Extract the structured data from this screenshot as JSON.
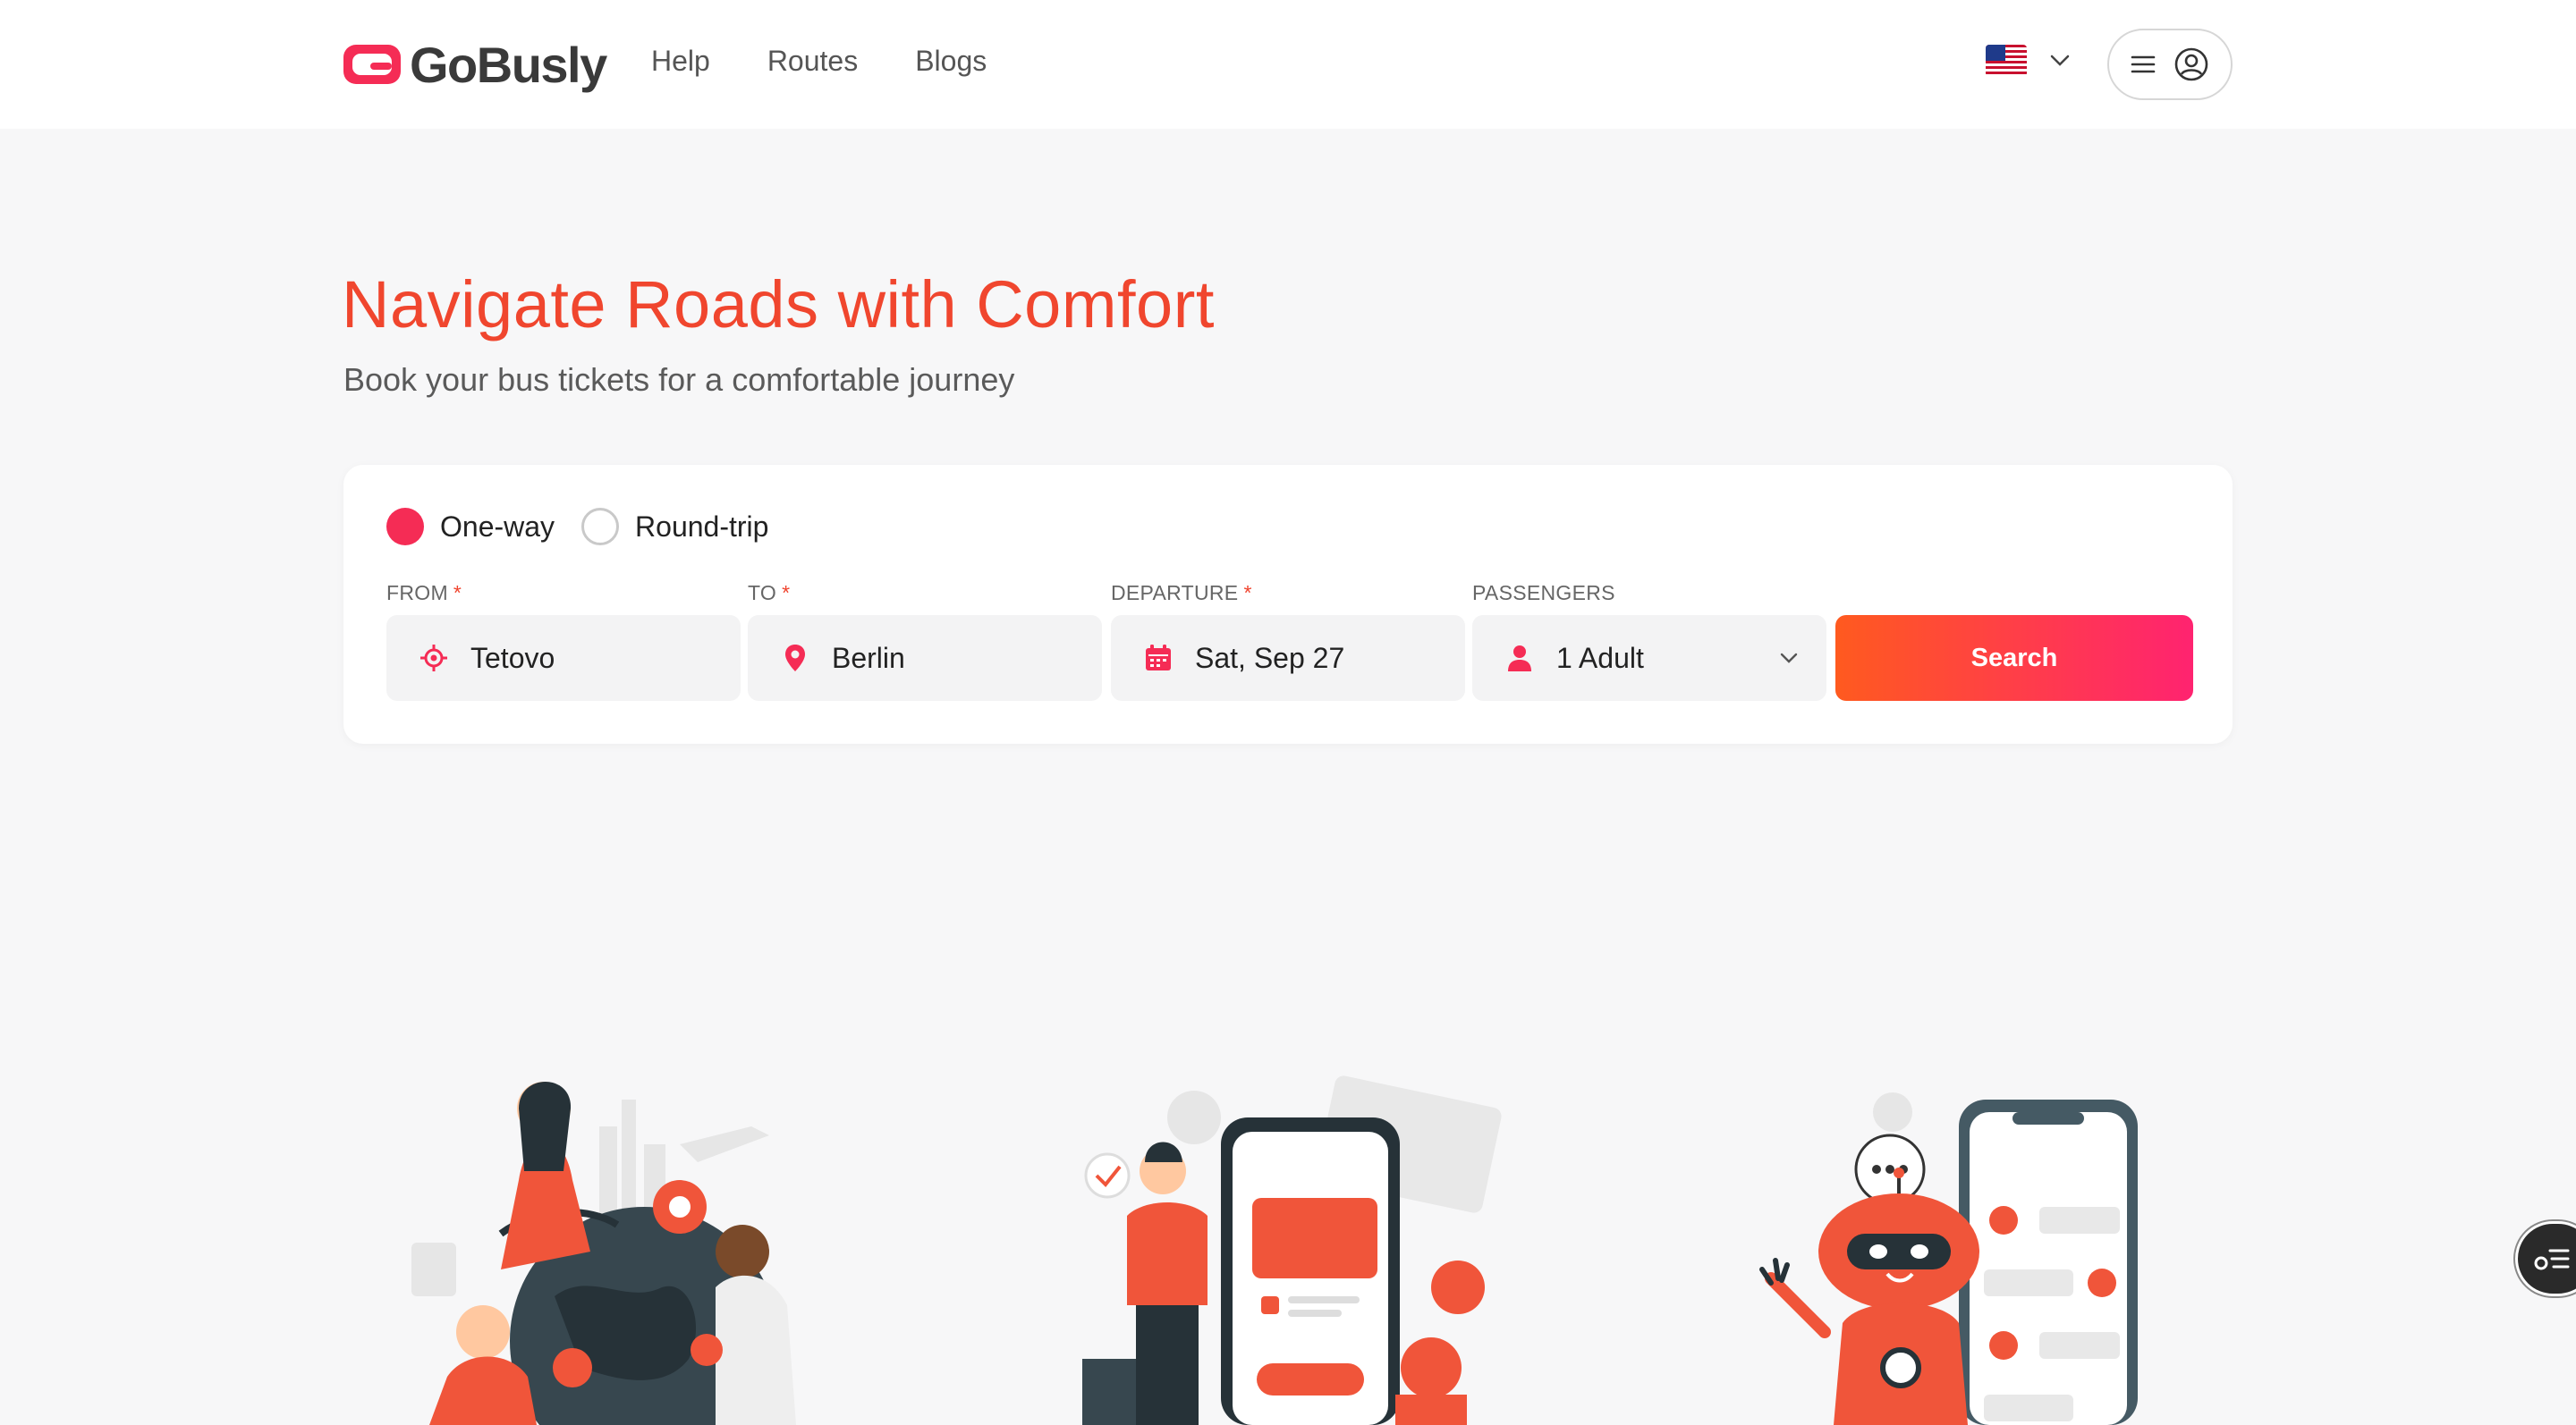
{
  "brand": {
    "name": "GoBusly",
    "color": "#f52c55"
  },
  "nav": {
    "items": [
      {
        "label": "Help"
      },
      {
        "label": "Routes"
      },
      {
        "label": "Blogs"
      }
    ]
  },
  "header": {
    "language_flag": "us-flag-icon",
    "menu_icon": "hamburger-icon",
    "account_icon": "user-circle-icon"
  },
  "hero": {
    "title": "Navigate Roads with Comfort",
    "subtitle": "Book your bus tickets for a comfortable journey"
  },
  "search": {
    "trip_types": [
      {
        "label": "One-way",
        "selected": true
      },
      {
        "label": "Round-trip",
        "selected": false
      }
    ],
    "from": {
      "label": "FROM",
      "required_mark": "*",
      "value": "Tetovo"
    },
    "to": {
      "label": "TO",
      "required_mark": "*",
      "value": "Berlin"
    },
    "departure": {
      "label": "DEPARTURE",
      "required_mark": "*",
      "value": "Sat, Sep 27"
    },
    "passengers": {
      "label": "PASSENGERS",
      "value": "1 Adult"
    },
    "submit_label": "Search"
  },
  "colors": {
    "accent": "#f0462e",
    "button_gradient_start": "#ff5a1f",
    "button_gradient_end": "#ff2370"
  }
}
